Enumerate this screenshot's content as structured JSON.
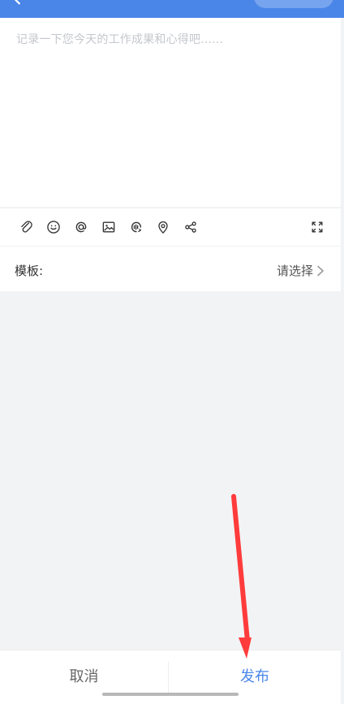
{
  "topbar": {
    "title": "",
    "accent": "#4a86e8"
  },
  "editor": {
    "placeholder": "记录一下您今天的工作成果和心得吧......"
  },
  "toolbar": {
    "icons": [
      "paperclip-icon",
      "emoji-icon",
      "at-icon",
      "image-icon",
      "voice-icon",
      "location-icon",
      "share-icon",
      "expand-icon"
    ]
  },
  "template": {
    "label": "模板:",
    "value": "请选择"
  },
  "bottom": {
    "cancel_label": "取消",
    "publish_label": "发布"
  },
  "colors": {
    "primary": "#4a86e8",
    "annotation": "#ff3b3b",
    "background": "#f2f3f5"
  }
}
